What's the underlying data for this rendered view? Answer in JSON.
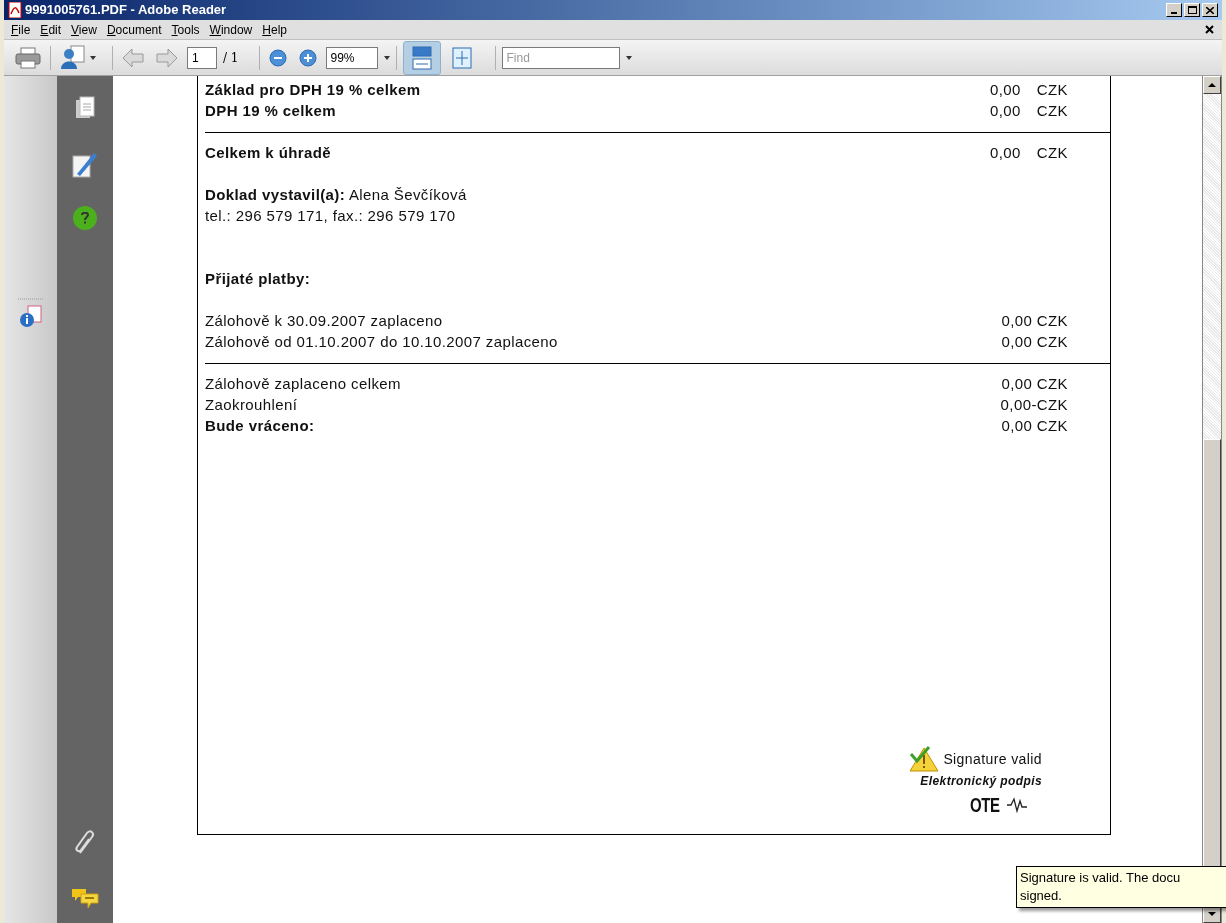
{
  "window": {
    "title": "9991005761.PDF - Adobe Reader"
  },
  "menu": [
    {
      "label": "File"
    },
    {
      "label": "Edit"
    },
    {
      "label": "View"
    },
    {
      "label": "Document"
    },
    {
      "label": "Tools"
    },
    {
      "label": "Window"
    },
    {
      "label": "Help"
    }
  ],
  "toolbar": {
    "previous_disabled": true,
    "next_disabled": true,
    "page": "1",
    "page_total": "/ 1",
    "zoom": "99%",
    "fit_width_selected": true,
    "fit_page_selected": false,
    "find_placeholder": "Find"
  },
  "document": {
    "lines": [
      {
        "kind": "amount",
        "label": "Základ pro DPH 19 % celkem",
        "amount": "0,00",
        "currency": "CZK",
        "bold": true
      },
      {
        "kind": "amount",
        "label": "DPH 19 % celkem",
        "amount": "0,00",
        "currency": "CZK",
        "bold": true
      },
      {
        "kind": "rule"
      },
      {
        "kind": "amount",
        "label": "Celkem k úhradě",
        "amount": "0,00",
        "currency": "CZK",
        "bold": true
      },
      {
        "kind": "gap"
      },
      {
        "kind": "text",
        "text": "**Doklad vystavil(a):** Alena Ševčíková"
      },
      {
        "kind": "text",
        "text": "tel.: 296 579 171, fax.: 296 579 170"
      },
      {
        "kind": "gap"
      },
      {
        "kind": "gap"
      },
      {
        "kind": "heading",
        "text": "Přijaté platby:"
      },
      {
        "kind": "gap"
      },
      {
        "kind": "payment",
        "label": "Zálohově k 30.09.2007 zaplaceno",
        "value": "0,00 CZK",
        "bold": false
      },
      {
        "kind": "payment",
        "label": "Zálohově od 01.10.2007 do 10.10.2007 zaplaceno",
        "value": "0,00 CZK",
        "bold": false
      },
      {
        "kind": "rule"
      },
      {
        "kind": "payment",
        "label": "Zálohově zaplaceno celkem",
        "value": "0,00 CZK",
        "bold": false
      },
      {
        "kind": "payment",
        "label": "Zaokrouhlení",
        "value": "0,00-CZK",
        "bold": false
      },
      {
        "kind": "payment",
        "label": "Bude vráceno:",
        "value": "0,00 CZK",
        "bold": true
      }
    ],
    "signature": {
      "status": "Signature valid",
      "caption": "Elektronický podpis",
      "logo": "OTE"
    }
  },
  "tooltip": {
    "lines": [
      "Signature is valid. The docu",
      "signed."
    ]
  }
}
